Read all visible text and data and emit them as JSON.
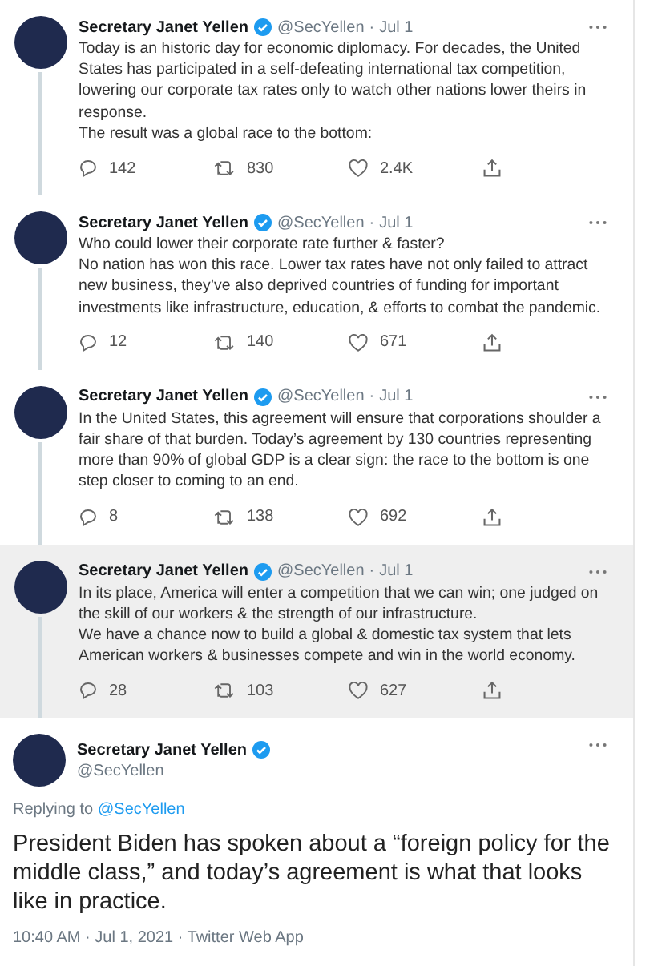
{
  "thread": [
    {
      "name": "Secretary Janet Yellen",
      "verified": true,
      "handle": "@SecYellen",
      "separator": "·",
      "date": "Jul 1",
      "highlighted": false,
      "paragraphs": [
        "Today is an historic day for economic diplomacy. For decades, the United States has participated in a self-defeating international tax competition, lowering our corporate tax rates only to watch other nations lower theirs in response.",
        "The result was a global race to the bottom:"
      ],
      "replies": "142",
      "retweets": "830",
      "likes": "2.4K"
    },
    {
      "name": "Secretary Janet Yellen",
      "verified": true,
      "handle": "@SecYellen",
      "separator": "·",
      "date": "Jul 1",
      "highlighted": false,
      "paragraphs": [
        "Who could lower their corporate rate further & faster?",
        "No nation has won this race. Lower tax rates have not only failed to attract new business, they’ve also deprived countries of funding for important investments like infrastructure, education, & efforts to combat the pandemic."
      ],
      "replies": "12",
      "retweets": "140",
      "likes": "671"
    },
    {
      "name": "Secretary Janet Yellen",
      "verified": true,
      "handle": "@SecYellen",
      "separator": "·",
      "date": "Jul 1",
      "highlighted": false,
      "paragraphs": [
        "In the United States, this agreement will ensure that corporations shoulder a fair share of that burden. Today’s agreement by 130 countries representing more than 90% of global GDP is a clear sign: the race to the bottom is one step closer to coming to an end."
      ],
      "replies": "8",
      "retweets": "138",
      "likes": "692"
    },
    {
      "name": "Secretary Janet Yellen",
      "verified": true,
      "handle": "@SecYellen",
      "separator": "·",
      "date": "Jul 1",
      "highlighted": true,
      "paragraphs": [
        "In its place, America will enter a competition that we can win; one judged on the skill of our workers & the strength of our infrastructure.",
        "We have a chance now to build a global & domestic tax system that lets American workers & businesses compete and win in the world economy."
      ],
      "replies": "28",
      "retweets": "103",
      "likes": "627"
    }
  ],
  "main_tweet": {
    "name": "Secretary Janet Yellen",
    "verified": true,
    "handle": "@SecYellen",
    "replying_label": "Replying to",
    "replying_to": "@SecYellen",
    "text": "President Biden has spoken about a “foreign policy for the middle class,” and today’s agreement is what that looks like in practice.",
    "meta": "10:40 AM · Jul 1, 2021 · Twitter Web App"
  }
}
